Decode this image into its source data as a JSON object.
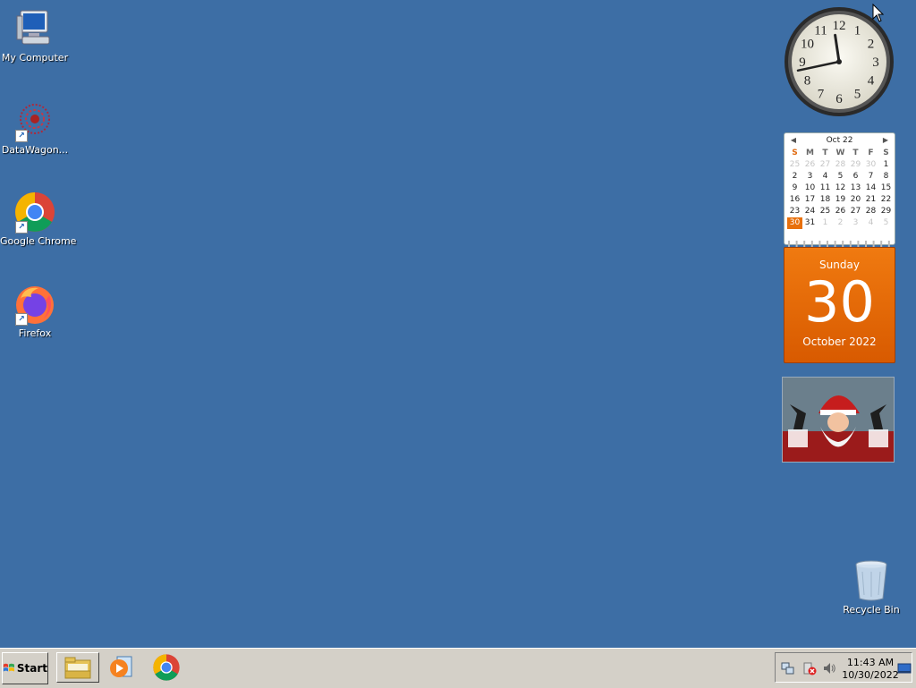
{
  "desktop": {
    "icons": [
      {
        "label": "My Computer"
      },
      {
        "label": "DataWagon..."
      },
      {
        "label": "Google Chrome"
      },
      {
        "label": "Firefox"
      },
      {
        "label": "Recycle Bin"
      }
    ]
  },
  "clock_gadget": {
    "numerals": [
      "12",
      "1",
      "2",
      "3",
      "4",
      "5",
      "6",
      "7",
      "8",
      "9",
      "10",
      "11"
    ],
    "time": "11:43"
  },
  "calendar_gadget": {
    "month_label": "Oct 22",
    "weekdays": [
      "S",
      "M",
      "T",
      "W",
      "T",
      "F",
      "S"
    ],
    "days": [
      "25",
      "26",
      "27",
      "28",
      "29",
      "30",
      "1",
      "2",
      "3",
      "4",
      "5",
      "6",
      "7",
      "8",
      "9",
      "10",
      "11",
      "12",
      "13",
      "14",
      "15",
      "16",
      "17",
      "18",
      "19",
      "20",
      "21",
      "22",
      "23",
      "24",
      "25",
      "26",
      "27",
      "28",
      "29",
      "30",
      "31",
      "1",
      "2",
      "3",
      "4",
      "5"
    ],
    "weekday": "Sunday",
    "day": "30",
    "month_year": "October 2022"
  },
  "taskbar": {
    "start_label": "Start",
    "clock_time": "11:43 AM",
    "clock_date": "10/30/2022"
  },
  "colors": {
    "desktop_bg": "#3d6ea5",
    "calendar_accent": "#e8700c",
    "taskbar_bg": "#d4d0c8"
  }
}
